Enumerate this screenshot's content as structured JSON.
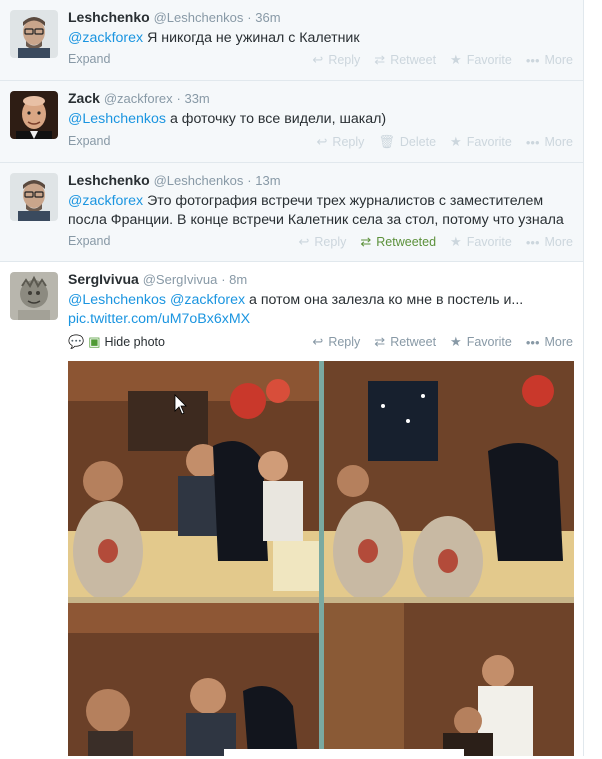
{
  "tweets": [
    {
      "name": "Leshchenko",
      "handle": "@Leshchenkos",
      "time": "· 36m",
      "mention": "@zackforex",
      "text": " Я никогда не ужинал с Калетник",
      "expand": "Expand",
      "actions": [
        "Reply",
        "Retweet",
        "Favorite",
        "More"
      ]
    },
    {
      "name": "Zack",
      "handle": "@zackforex",
      "time": "· 33m",
      "mention": "@Leshchenkos",
      "text": " а фоточку то все видели, шакал)",
      "expand": "Expand",
      "actions": [
        "Reply",
        "Delete",
        "Favorite",
        "More"
      ]
    },
    {
      "name": "Leshchenko",
      "handle": "@Leshchenkos",
      "time": "· 13m",
      "mention": "@zackforex",
      "text_line1": " Это фотография встречи трех журналистов с заместителем",
      "text_line2": "посла Франции. В конце встречи Калетник села за стол, потому что узнала",
      "expand": "Expand",
      "actions": [
        "Reply",
        "Retweeted",
        "Favorite",
        "More"
      ]
    },
    {
      "name": "SergIvivua",
      "handle": "@SergIvivua",
      "time": "· 8m",
      "mention1": "@Leshchenkos",
      "mention2": "@zackforex",
      "text": " а потом она залезла ко мне в постель и...",
      "link": "pic.twitter.com/uM7oBx6xMX",
      "hide_photo": "Hide photo",
      "actions": [
        "Reply",
        "Retweet",
        "Favorite",
        "More"
      ]
    }
  ],
  "colors": {
    "link": "#1b95e0",
    "retweeted": "#5c913b",
    "muted": "#8899a6",
    "collapsed_bg": "#f5f8fa"
  },
  "icons": [
    "reply-icon",
    "retweet-icon",
    "favorite-icon",
    "more-icon",
    "delete-icon",
    "comment-icon",
    "photo-icon"
  ]
}
